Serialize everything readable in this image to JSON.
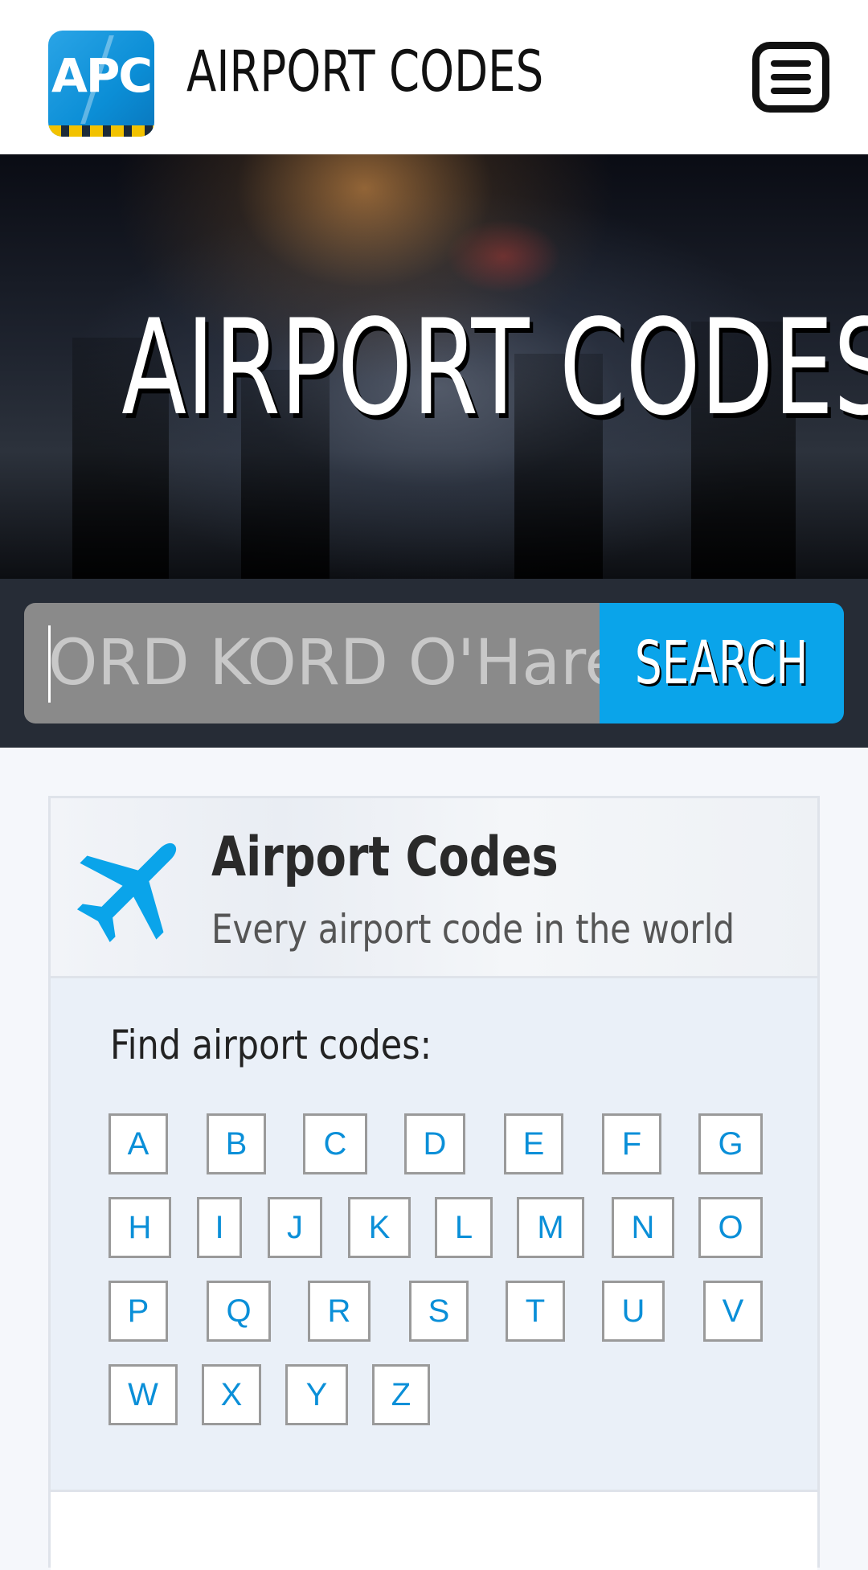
{
  "header": {
    "logo_text": "APC",
    "site_title": "AIRPORT CODES",
    "menu_icon": "hamburger-menu-icon"
  },
  "hero": {
    "title": "AIRPORT CODES"
  },
  "search": {
    "placeholder": "ORD KORD O'Hare",
    "button_label": "SEARCH"
  },
  "card": {
    "icon": "airplane-icon",
    "title": "Airport Codes",
    "subtitle": "Every airport code in the world",
    "find_label": "Find airport codes:",
    "letters": [
      "A",
      "B",
      "C",
      "D",
      "E",
      "F",
      "G",
      "H",
      "I",
      "J",
      "K",
      "L",
      "M",
      "N",
      "O",
      "P",
      "Q",
      "R",
      "S",
      "T",
      "U",
      "V",
      "W",
      "X",
      "Y",
      "Z"
    ]
  },
  "colors": {
    "accent": "#0aa4ea",
    "link": "#0a8fd8",
    "search_strip": "#262c36"
  }
}
